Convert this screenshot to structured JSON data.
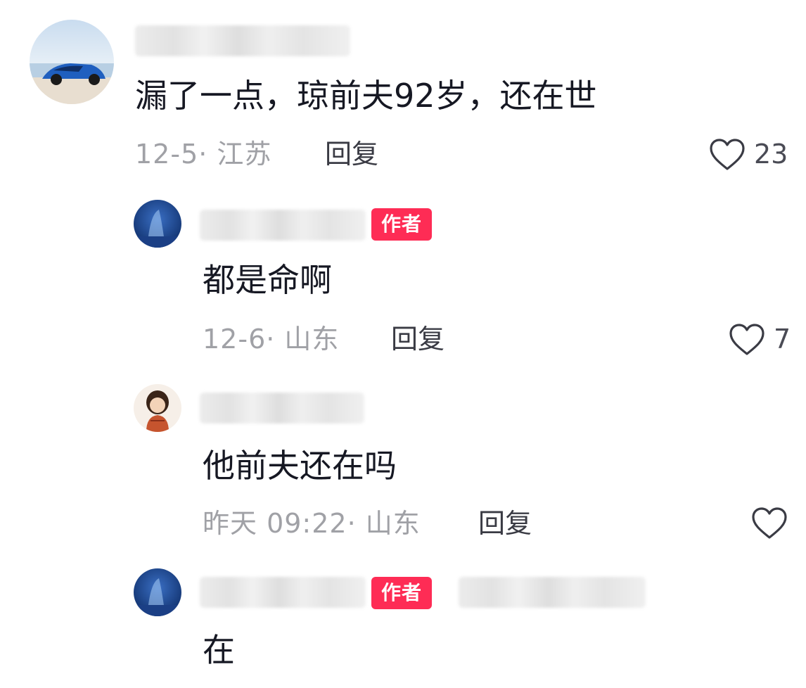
{
  "comments": [
    {
      "text": "漏了一点，琼前夫92岁，还在世",
      "date_location": "12-5· 江苏",
      "reply_label": "回复",
      "likes": "23",
      "is_author": false
    },
    {
      "text": "都是命啊",
      "date_location": "12-6· 山东",
      "reply_label": "回复",
      "likes": "7",
      "is_author": true,
      "badge": "作者"
    },
    {
      "text": "他前夫还在吗",
      "date_location": "昨天 09:22· 山东",
      "reply_label": "回复",
      "likes": "",
      "is_author": false
    },
    {
      "text": "在",
      "is_author": true,
      "badge": "作者"
    }
  ],
  "colors": {
    "badge_bg": "#fe2c55",
    "meta_text": "#a0a1a6",
    "body_text": "#161823"
  },
  "icons": {
    "like": "heart-outline-icon"
  }
}
